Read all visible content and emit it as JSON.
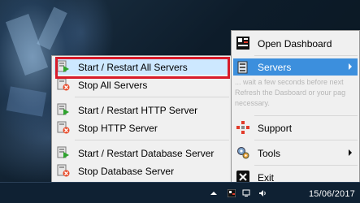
{
  "context_menu": {
    "items": [
      {
        "label": "Start / Restart All Servers",
        "icon": "start-server-icon"
      },
      {
        "label": "Stop All Servers",
        "icon": "stop-server-icon"
      },
      {
        "label": "Start / Restart HTTP Server",
        "icon": "start-server-icon"
      },
      {
        "label": "Stop HTTP Server",
        "icon": "stop-server-icon"
      },
      {
        "label": "Start / Restart Database Server",
        "icon": "start-server-icon"
      },
      {
        "label": "Stop Database Server",
        "icon": "stop-server-icon"
      }
    ],
    "highlight_color": "#d81c2a"
  },
  "tray_menu": {
    "open_dashboard": "Open Dashboard",
    "servers": "Servers",
    "note": "... wait a few seconds before next Refresh the Dasboard or your pag necessary.",
    "support": "Support",
    "tools": "Tools",
    "exit": "Exit",
    "selected_color": "#3c8fdd"
  },
  "taskbar": {
    "date": "15/06/2017"
  }
}
